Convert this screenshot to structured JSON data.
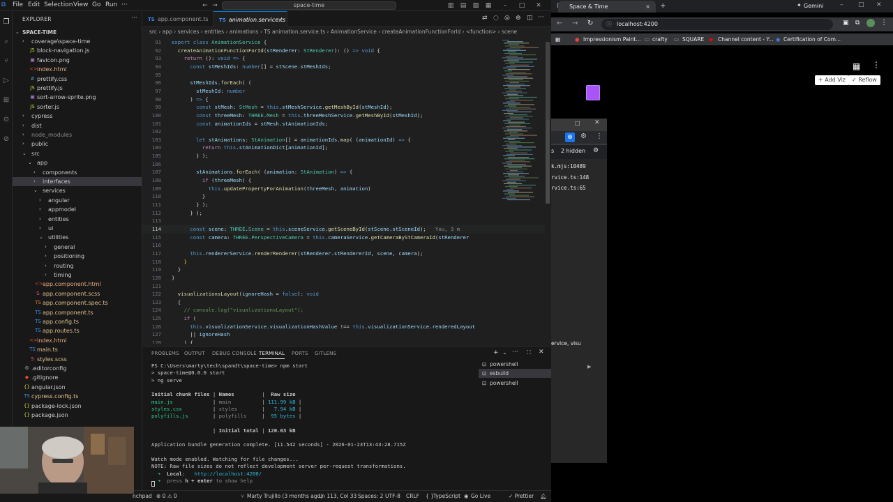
{
  "vscode": {
    "menu": [
      "File",
      "Edit",
      "Selection",
      "View",
      "Go",
      "Run"
    ],
    "command_center": "space-time",
    "explorer_title": "EXPLORER",
    "project": "SPACE-TIME",
    "tree": [
      {
        "d": 1,
        "t": "file",
        "n": "coverage\\space-time",
        "i": "dir",
        "chev": "›"
      },
      {
        "d": 2,
        "t": "file",
        "n": "block-navigation.js",
        "i": "js"
      },
      {
        "d": 2,
        "t": "file",
        "n": "favicon.png",
        "i": "img"
      },
      {
        "d": 2,
        "t": "file",
        "n": "index.html",
        "i": "html"
      },
      {
        "d": 2,
        "t": "file",
        "n": "prettify.css",
        "i": "css"
      },
      {
        "d": 2,
        "t": "file",
        "n": "prettify.js",
        "i": "js"
      },
      {
        "d": 2,
        "t": "file",
        "n": "sort-arrow-sprite.png",
        "i": "img"
      },
      {
        "d": 2,
        "t": "file",
        "n": "sorter.js",
        "i": "js"
      },
      {
        "d": 1,
        "t": "dir",
        "n": "cypress",
        "chev": "›"
      },
      {
        "d": 1,
        "t": "dir",
        "n": "dist",
        "chev": "›"
      },
      {
        "d": 1,
        "t": "dir",
        "n": "node_modules",
        "chev": "›",
        "dim": true
      },
      {
        "d": 1,
        "t": "dir",
        "n": "public",
        "chev": "›"
      },
      {
        "d": 1,
        "t": "dir",
        "n": "src",
        "chev": "⌄"
      },
      {
        "d": 2,
        "t": "dir",
        "n": "app",
        "chev": "⌄"
      },
      {
        "d": 3,
        "t": "dir",
        "n": "components",
        "chev": "›"
      },
      {
        "d": 3,
        "t": "dir",
        "n": "interfaces",
        "chev": "›",
        "sel": true
      },
      {
        "d": 3,
        "t": "dir",
        "n": "services",
        "chev": "⌄"
      },
      {
        "d": 4,
        "t": "dir",
        "n": "angular",
        "chev": "›"
      },
      {
        "d": 4,
        "t": "dir",
        "n": "appmodel",
        "chev": "›"
      },
      {
        "d": 4,
        "t": "dir",
        "n": "entities",
        "chev": "›"
      },
      {
        "d": 4,
        "t": "dir",
        "n": "ui",
        "chev": "›"
      },
      {
        "d": 4,
        "t": "dir",
        "n": "utilities",
        "chev": "⌄"
      },
      {
        "d": 5,
        "t": "dir",
        "n": "general",
        "chev": "›"
      },
      {
        "d": 5,
        "t": "dir",
        "n": "positioning",
        "chev": "›"
      },
      {
        "d": 5,
        "t": "dir",
        "n": "routing",
        "chev": "›"
      },
      {
        "d": 5,
        "t": "dir",
        "n": "timing",
        "chev": "›"
      },
      {
        "d": 3,
        "t": "file",
        "n": "app.component.html",
        "i": "html"
      },
      {
        "d": 3,
        "t": "file",
        "n": "app.component.scss",
        "i": "scss"
      },
      {
        "d": 3,
        "t": "file",
        "n": "app.component.spec.ts",
        "i": "spec"
      },
      {
        "d": 3,
        "t": "file",
        "n": "app.component.ts",
        "i": "ts"
      },
      {
        "d": 3,
        "t": "file",
        "n": "app.config.ts",
        "i": "ts"
      },
      {
        "d": 3,
        "t": "file",
        "n": "app.routes.ts",
        "i": "ts"
      },
      {
        "d": 2,
        "t": "file",
        "n": "index.html",
        "i": "html"
      },
      {
        "d": 2,
        "t": "file",
        "n": "main.ts",
        "i": "ts"
      },
      {
        "d": 2,
        "t": "file",
        "n": "styles.scss",
        "i": "scss"
      },
      {
        "d": 1,
        "t": "file",
        "n": ".editorconfig",
        "i": "cfg"
      },
      {
        "d": 1,
        "t": "file",
        "n": ".gitignore",
        "i": "git"
      },
      {
        "d": 1,
        "t": "file",
        "n": "angular.json",
        "i": "json"
      },
      {
        "d": 1,
        "t": "file",
        "n": "cypress.config.ts",
        "i": "ts"
      },
      {
        "d": 1,
        "t": "file",
        "n": "package-lock.json",
        "i": "json"
      },
      {
        "d": 1,
        "t": "file",
        "n": "package.json",
        "i": "json"
      }
    ],
    "tabs": [
      {
        "label": "app.component.ts",
        "active": false
      },
      {
        "label": "animation.service.ts",
        "active": true
      }
    ],
    "close_glyph": "×",
    "breadcrumb": "src › app › services › entities › animations › TS animation.service.ts › AnimationService › createAnimationFunctionForId › <function> › scene",
    "code": [
      {
        "n": "91",
        "h": "<span class=\"k\">export</span> <span class=\"k\">class</span> <span class=\"t\">AnimationService</span> {"
      },
      {
        "n": "92",
        "h": "  <span class=\"f\">createAnimationFunctionForId</span>(<span class=\"v\">stRenderer</span>: <span class=\"t\">StRenderer</span>): () <span class=\"k\">=></span> <span class=\"k\">void</span> {"
      },
      {
        "n": "93",
        "h": "    <span class=\"kc\">return</span> (): <span class=\"k\">void</span> <span class=\"k\">=></span> {"
      },
      {
        "n": "94",
        "h": "      <span class=\"k\">const</span> <span class=\"v\">stMeshIds</span>: <span class=\"k\">number</span>[] = <span class=\"v\">stScene</span>.<span class=\"v\">stMeshIds</span>;"
      },
      {
        "n": "95",
        "h": ""
      },
      {
        "n": "96",
        "h": "      <span class=\"v\">stMeshIds</span>.<span class=\"f\">forEach</span>( ("
      },
      {
        "n": "97",
        "h": "        <span class=\"v\">stMeshId</span>: <span class=\"k\">number</span>"
      },
      {
        "n": "98",
        "h": "      ) <span class=\"k\">=></span> {"
      },
      {
        "n": "99",
        "h": "        <span class=\"k\">const</span> <span class=\"v\">stMesh</span>: <span class=\"t\">StMesh</span> = <span class=\"k\">this</span>.<span class=\"v\">stMeshService</span>.<span class=\"f\">getMeshById</span>(<span class=\"v\">stMeshId</span>);"
      },
      {
        "n": "100",
        "h": "        <span class=\"k\">const</span> <span class=\"v\">threeMesh</span>: <span class=\"t\">THREE</span>.<span class=\"t\">Mesh</span> = <span class=\"k\">this</span>.<span class=\"v\">threeMeshService</span>.<span class=\"f\">getMeshById</span>(<span class=\"v\">stMeshId</span>);"
      },
      {
        "n": "101",
        "h": "        <span class=\"k\">const</span> <span class=\"v\">animationIds</span> = <span class=\"v\">stMesh</span>.<span class=\"v\">stAnimationIds</span>;"
      },
      {
        "n": "102",
        "h": ""
      },
      {
        "n": "103",
        "h": "        <span class=\"k\">let</span> <span class=\"v\">stAnimations</span>: <span class=\"t\">StAnimation</span>[] = <span class=\"v\">animationIds</span>.<span class=\"f\">map</span>( (<span class=\"v\">animationId</span>) <span class=\"k\">=></span> {"
      },
      {
        "n": "104",
        "h": "          <span class=\"kc\">return</span> <span class=\"k\">this</span>.<span class=\"v\">stAnimationDict</span>[<span class=\"v\">animationId</span>];"
      },
      {
        "n": "105",
        "h": "        } );"
      },
      {
        "n": "106",
        "h": ""
      },
      {
        "n": "107",
        "h": "        <span class=\"v\">stAnimations</span>.<span class=\"f\">forEach</span>( (<span class=\"v\">animation</span>: <span class=\"t\">StAnimation</span>) <span class=\"k\">=></span> {"
      },
      {
        "n": "108",
        "h": "          <span class=\"kc\">if</span> (<span class=\"v\">threeMesh</span>) {"
      },
      {
        "n": "109",
        "h": "            <span class=\"k\">this</span>.<span class=\"f\">updatePropertyForAnimation</span>(<span class=\"v\">threeMesh</span>, <span class=\"v\">animation</span>)"
      },
      {
        "n": "110",
        "h": "          }"
      },
      {
        "n": "111",
        "h": "        } );"
      },
      {
        "n": "112",
        "h": "      } );"
      },
      {
        "n": "113",
        "h": ""
      },
      {
        "n": "114",
        "h": "      <span class=\"k\">const</span> <span class=\"v\">scene</span>: <span class=\"t\">THREE</span>.<span class=\"t\">Scene</span> = <span class=\"k\">this</span>.<span class=\"v\">sceneService</span>.<span class=\"f\">getSceneById</span>(<span class=\"v\">stScene</span>.<span class=\"v\">stSceneId</span>);   <span class=\"tgr\">You, 3 m</span>",
        "cur": true
      },
      {
        "n": "115",
        "h": "      <span class=\"k\">const</span> <span class=\"v\">camera</span>: <span class=\"t\">THREE</span>.<span class=\"t\">PerspectiveCamera</span> = <span class=\"k\">this</span>.<span class=\"v\">cameraService</span>.<span class=\"f\">getCameraByStCameraId</span>(<span class=\"v\">stRenderer</span>"
      },
      {
        "n": "116",
        "h": ""
      },
      {
        "n": "117",
        "h": "      <span class=\"k\">this</span>.<span class=\"v\">rendererService</span>.<span class=\"f\">renderRenderer</span>(<span class=\"v\">stRenderer</span>.<span class=\"v\">stRendererId</span>, <span class=\"v\">scene</span>, <span class=\"v\">camera</span>);"
      },
      {
        "n": "118",
        "h": "    <span class=\"p\">}</span>"
      },
      {
        "n": "119",
        "h": "  }"
      },
      {
        "n": "120",
        "h": "}"
      },
      {
        "n": "121",
        "h": ""
      },
      {
        "n": "122",
        "h": "  <span class=\"f\">visualizationsLayout</span>(<span class=\"v\">ignoreHash</span> = <span class=\"k\">false</span>): <span class=\"k\">void</span>"
      },
      {
        "n": "123",
        "h": "  {"
      },
      {
        "n": "124",
        "h": "    <span class=\"c\">// console.log(\"visualizationsLayout\");</span>"
      },
      {
        "n": "125",
        "h": "    <span class=\"kc\">if</span> ("
      },
      {
        "n": "126",
        "h": "      <span class=\"k\">this</span>.<span class=\"v\">visualizationService</span>.<span class=\"v\">visualizationHashValue</span> !== <span class=\"k\">this</span>.<span class=\"v\">visualizationService</span>.<span class=\"v\">renderedLayout</span>"
      },
      {
        "n": "127",
        "h": "      || <span class=\"v\">ignoreHash</span>"
      },
      {
        "n": "128",
        "h": "    ) {"
      }
    ],
    "panel_tabs": [
      "PROBLEMS",
      "OUTPUT",
      "DEBUG CONSOLE",
      "TERMINAL",
      "PORTS",
      "GITLENS"
    ],
    "terminal": [
      {
        "h": "PS C:\\Users\\marty\\tech\\spandt\\space-time> npm start"
      },
      {
        "h": "> space-time@0.0.0 start"
      },
      {
        "h": "> ng serve"
      },
      {
        "h": ""
      },
      {
        "h": "<b>Initial chunk files</b> | <b>Names</b>         |  <b>Raw size</b>"
      },
      {
        "h": "<span class=\"tg\">main.js</span>             | <span class=\"tgr\">main</span>          | <span class=\"tc\">111.99 kB</span> |"
      },
      {
        "h": "<span class=\"tg\">styles.css</span>          | <span class=\"tgr\">styles</span>        |   <span class=\"tc\">7.94 kB</span> |"
      },
      {
        "h": "<span class=\"tg\">polyfills.js</span>        | <span class=\"tgr\">polyfills</span>     |  <span class=\"tc\">95 bytes</span> |"
      },
      {
        "h": ""
      },
      {
        "h": "                    | <b>Initial total</b> | <b>120.03 kB</b>"
      },
      {
        "h": ""
      },
      {
        "h": "Application bundle generation complete. [11.542 seconds] - 2026-01-23T13:43:28.715Z"
      },
      {
        "h": ""
      },
      {
        "h": "Watch mode enabled. Watching for file changes..."
      },
      {
        "h": "NOTE: Raw file sizes do not reflect development server per-request transformations."
      },
      {
        "h": "  <span class=\"tg\">➜</span>  <b>Local</b>:   <span class=\"tc\">http://localhost:4200/</span>"
      },
      {
        "h": "  <span class=\"tg\">➜</span>  <span class=\"tgr\">press</span> <b>h + enter</b> <span class=\"tgr\">to show help</span>"
      }
    ],
    "terminal_list": [
      {
        "label": "powershell",
        "sel": false
      },
      {
        "label": "esbuild",
        "sel": true
      },
      {
        "label": "powershell",
        "sel": false
      }
    ],
    "status": {
      "left": "nchpad",
      "problems": "⊗ 0 ⚠ 0",
      "blame": "Marty Trujillo (3 months ago)",
      "position": "Ln 113, Col 33",
      "spaces": "Spaces: 2",
      "encoding": "UTF-8",
      "eol": "CRLF",
      "language": "TypeScript",
      "golive": "Go Live",
      "prettier": "✓ Prettier"
    }
  },
  "chrome": {
    "tab_title": "Space & Time",
    "gemini": "Gemini",
    "url": "localhost:4200",
    "bookmarks": [
      "Impressionism Paint...",
      "crafty",
      "SQUARE",
      "Channel content - Y...",
      "Certification of Com..."
    ],
    "add_viz": "Add Viz",
    "reflow": "Reflow",
    "devtools": {
      "hidden": "2 hidden",
      "lines": [
        "k.mjs:10489",
        "rvice.ts:148",
        "rvice.ts:65"
      ],
      "footer": "ervice, visu"
    }
  },
  "colors": {
    "accent": "#0078d4",
    "cube": "#a855f7"
  }
}
